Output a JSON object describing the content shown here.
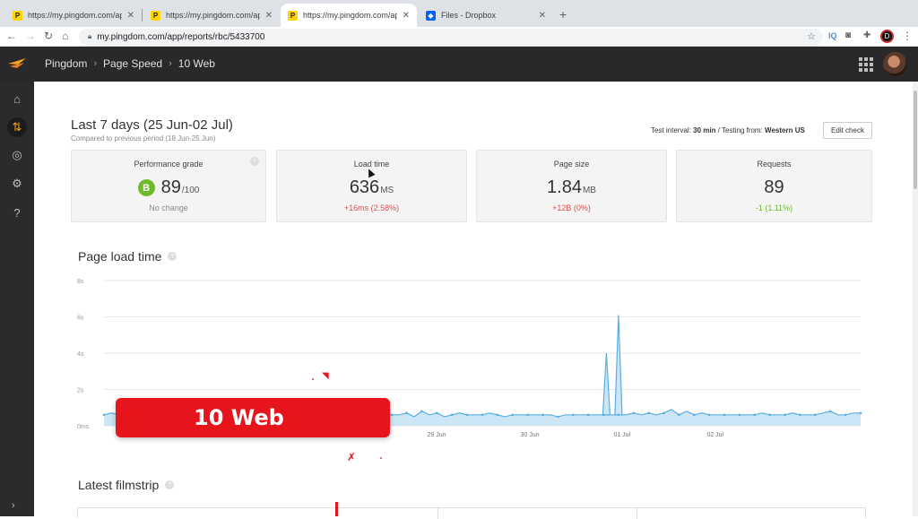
{
  "browser": {
    "tabs": [
      {
        "title": "https://my.pingdom.com/app/r",
        "favicon": "P"
      },
      {
        "title": "https://my.pingdom.com/app/r",
        "favicon": "P"
      },
      {
        "title": "https://my.pingdom.com/app/r",
        "favicon": "P",
        "active": true
      },
      {
        "title": "Files - Dropbox",
        "favicon": "dropbox-icon"
      }
    ],
    "url": "my.pingdom.com/app/reports/rbc/5433700",
    "iq_label": "IQ",
    "profile_initial": "D"
  },
  "app": {
    "breadcrumb": [
      "Pingdom",
      "Page Speed",
      "10 Web"
    ]
  },
  "report": {
    "period_title": "Last 7 days (25 Jun-02 Jul)",
    "period_compare": "Compared to previous period (18 Jun-25 Jun)",
    "interval_label": "Test interval:",
    "interval_value": "30 min",
    "from_label": "/ Testing from:",
    "from_value": "Western US",
    "edit_button": "Edit check"
  },
  "metrics": [
    {
      "title": "Performance grade",
      "grade": "B",
      "value": "89",
      "unit": "/100",
      "delta": "No change",
      "delta_type": "neutral"
    },
    {
      "title": "Load time",
      "value": "636",
      "unit": "MS",
      "delta": "+16ms (2.58%)",
      "delta_type": "neg"
    },
    {
      "title": "Page size",
      "value": "1.84",
      "unit": "MB",
      "delta": "+12B (0%)",
      "delta_type": "neg"
    },
    {
      "title": "Requests",
      "value": "89",
      "unit": "",
      "delta": "-1 (1.11%)",
      "delta_type": "pos"
    }
  ],
  "sections": {
    "page_load_time": "Page load time",
    "latest_filmstrip": "Latest filmstrip"
  },
  "chart_data": {
    "type": "area",
    "title": "",
    "xlabel": "",
    "ylabel": "",
    "y_tick_labels": [
      "0ms",
      "2s",
      "4s",
      "6s",
      "8s"
    ],
    "ylim": [
      0,
      8
    ],
    "x_tick_labels": [
      "29 Jun",
      "30 Jun",
      "01 Jul",
      "02 Jul"
    ],
    "color": "#5aaee0",
    "fill": "#cce6f6",
    "series": [
      {
        "x": [
          0.0,
          0.01,
          0.02,
          0.03,
          0.04,
          0.05,
          0.06,
          0.07,
          0.08,
          0.09,
          0.1,
          0.11,
          0.12,
          0.13,
          0.14,
          0.15,
          0.16,
          0.17,
          0.18,
          0.19,
          0.2,
          0.21,
          0.22,
          0.23,
          0.24,
          0.25,
          0.26,
          0.27,
          0.28,
          0.29,
          0.3,
          0.31,
          0.32,
          0.33,
          0.34,
          0.35,
          0.36,
          0.37,
          0.38,
          0.39,
          0.4,
          0.41,
          0.42,
          0.43,
          0.44,
          0.45,
          0.46,
          0.47,
          0.48,
          0.49,
          0.5,
          0.51,
          0.52,
          0.53,
          0.54,
          0.55,
          0.56,
          0.57,
          0.58,
          0.59,
          0.6,
          0.61,
          0.62,
          0.63,
          0.64,
          0.65,
          0.66,
          0.67,
          0.68,
          0.69,
          0.7,
          0.71,
          0.72,
          0.73,
          0.74,
          0.75,
          0.76,
          0.77,
          0.78,
          0.79,
          0.8,
          0.81,
          0.82,
          0.83,
          0.84,
          0.85,
          0.86,
          0.87,
          0.88,
          0.89,
          0.9,
          0.91,
          0.92,
          0.93,
          0.94,
          0.95,
          0.96,
          0.97,
          0.98,
          0.99,
          1.0
        ],
        "values": [
          0.6,
          0.7,
          0.6,
          0.6,
          0.7,
          0.6,
          0.6,
          0.6,
          0.7,
          0.6,
          0.6,
          0.7,
          0.6,
          0.6,
          0.6,
          0.7,
          0.6,
          0.6,
          0.6,
          0.6,
          0.6,
          0.6,
          0.6,
          0.7,
          0.6,
          0.6,
          0.6,
          0.6,
          0.6,
          0.6,
          0.7,
          0.6,
          0.6,
          0.6,
          0.6,
          0.6,
          0.7,
          0.8,
          0.6,
          0.6,
          0.7,
          0.5,
          0.8,
          0.6,
          0.7,
          0.5,
          0.6,
          0.7,
          0.6,
          0.6,
          0.6,
          0.7,
          0.6,
          0.5,
          0.6,
          0.6,
          0.6,
          0.6,
          0.6,
          0.6,
          0.5,
          0.6,
          0.6,
          0.6,
          0.6,
          0.6,
          0.6,
          0.6,
          0.6,
          0.6,
          0.7,
          0.6,
          0.7,
          0.6,
          0.7,
          0.9,
          0.6,
          0.8,
          0.6,
          0.7,
          0.6,
          0.6,
          0.6,
          0.6,
          0.6,
          0.6,
          0.6,
          0.7,
          0.6,
          0.6,
          0.6,
          0.7,
          0.6,
          0.6,
          0.6,
          0.7,
          0.8,
          0.6,
          0.6,
          0.7,
          0.7
        ]
      }
    ]
  },
  "overlay": {
    "banner_text": "10 Web"
  }
}
